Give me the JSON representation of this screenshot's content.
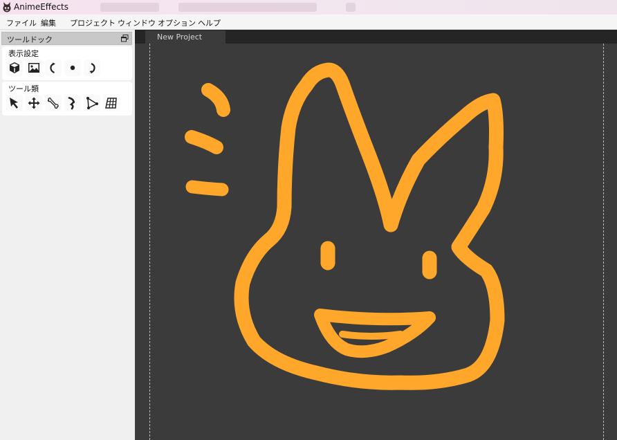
{
  "window": {
    "title": "AnimeEffects"
  },
  "menu": {
    "items": [
      "ファイル",
      "編集",
      "プロジェクト",
      "ウィンドウ",
      "オプション",
      "ヘルプ"
    ]
  },
  "dock": {
    "title": "ツールドック",
    "display_settings": {
      "label": "表示設定",
      "icons": [
        "cube-icon",
        "image-icon",
        "rotate-left-icon",
        "dot-icon",
        "rotate-right-icon"
      ]
    },
    "tools": {
      "label": "ツール類",
      "icons": [
        "cursor-icon",
        "move-icon",
        "bone-icon",
        "pose-icon",
        "mesh-vertex-icon",
        "grid-deform-icon"
      ]
    }
  },
  "document": {
    "tab_label": "New Project"
  },
  "colors": {
    "drawing": "#ffa72a",
    "canvas_bg": "#3b3b3b",
    "tabstrip_bg": "#252525",
    "dock_bg": "#f0f0f0"
  }
}
